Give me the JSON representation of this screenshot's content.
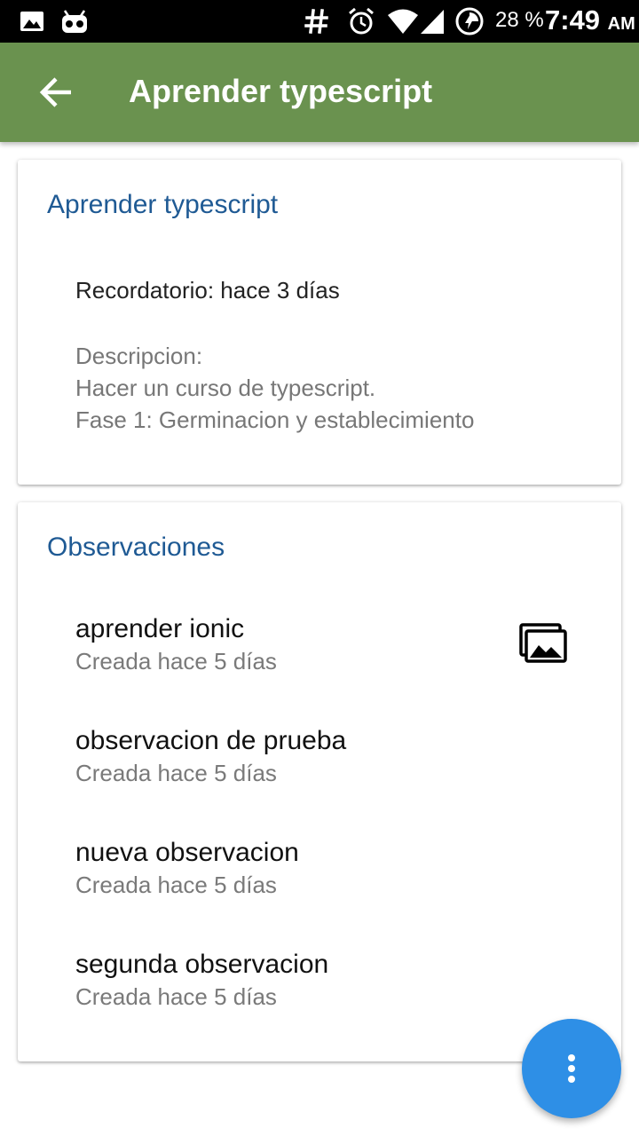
{
  "status_bar": {
    "battery_text": "28 %",
    "time": "7:49",
    "ampm": "AM",
    "icons": [
      "image-icon",
      "android-head-icon",
      "hash-icon",
      "alarm-icon",
      "wifi-icon",
      "signal-icon",
      "battery-charging-icon"
    ]
  },
  "toolbar": {
    "title": "Aprender typescript",
    "back_icon": "arrow-back-icon",
    "background": "#6a924f"
  },
  "task_card": {
    "title": "Aprender typescript",
    "reminder": "Recordatorio: hace 3 días",
    "description_label": "Descripcion:",
    "description_lines": [
      "Hacer un curso de typescript.",
      "Fase 1: Germinacion y establecimiento"
    ]
  },
  "observations_card": {
    "title": "Observaciones",
    "items": [
      {
        "title": "aprender ionic",
        "subtitle": "Creada hace 5 días",
        "icon": "image-gallery-icon"
      },
      {
        "title": "observacion de prueba",
        "subtitle": "Creada hace 5 días"
      },
      {
        "title": "nueva observacion",
        "subtitle": "Creada hace 5 días"
      },
      {
        "title": "segunda observacion",
        "subtitle": "Creada hace 5 días"
      }
    ]
  },
  "fab": {
    "icon": "more-vertical-icon",
    "color": "#2e8fe6"
  },
  "colors": {
    "accent_title": "#1f5a94"
  }
}
